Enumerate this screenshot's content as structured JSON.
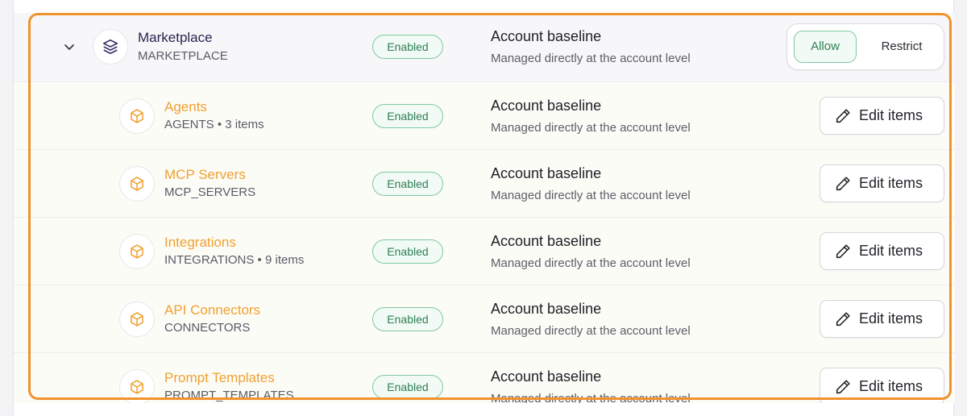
{
  "parent": {
    "name": "Marketplace",
    "code": "MARKETPLACE",
    "status": "Enabled",
    "baseline": "Account baseline",
    "managed": "Managed directly at the account level",
    "allow_label": "Allow",
    "restrict_label": "Restrict",
    "icon": "layers-icon",
    "expand_icon": "chevron-down-icon"
  },
  "children": [
    {
      "name": "Agents",
      "code": "AGENTS • 3 items",
      "status": "Enabled",
      "baseline": "Account baseline",
      "managed": "Managed directly at the account level",
      "action": "Edit items"
    },
    {
      "name": "MCP Servers",
      "code": "MCP_SERVERS",
      "status": "Enabled",
      "baseline": "Account baseline",
      "managed": "Managed directly at the account level",
      "action": "Edit items"
    },
    {
      "name": "Integrations",
      "code": "INTEGRATIONS • 9 items",
      "status": "Enabled",
      "baseline": "Account baseline",
      "managed": "Managed directly at the account level",
      "action": "Edit items"
    },
    {
      "name": "API Connectors",
      "code": "CONNECTORS",
      "status": "Enabled",
      "baseline": "Account baseline",
      "managed": "Managed directly at the account level",
      "action": "Edit items"
    },
    {
      "name": "Prompt Templates",
      "code": "PROMPT_TEMPLATES",
      "status": "Enabled",
      "baseline": "Account baseline",
      "managed": "Managed directly at the account level",
      "action": "Edit items"
    }
  ],
  "colors": {
    "accent_orange": "#f0922d",
    "enabled_green": "#2f7f56",
    "child_name": "#f0a030"
  },
  "icons": {
    "child_item": "box-icon",
    "edit": "pencil-icon"
  }
}
